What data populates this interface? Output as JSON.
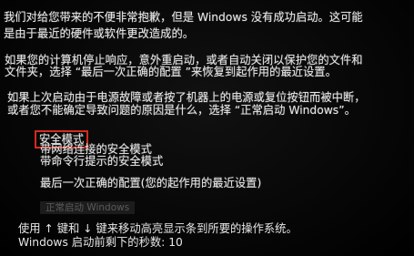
{
  "intro": {
    "line1": "我们对给您带来的不便非常抱歉，但是 Windows 没有成功启动。这可能",
    "line2": "是由于最近的硬件或软件更改造成的。"
  },
  "paragraph2": {
    "line1": "如果您的计算机停止响应，意外重启动，或者自动关闭以保护您的文件和",
    "line2": "文件夹，选择 “最后一次正确的配置 ”来恢复到起作用的最近设置。"
  },
  "paragraph3": {
    "line1": "如果上次启动由于电源故障或者按了机器上的电源或复位按钮而被中断，",
    "line2": "或者您不能确定导致问题的原因是什么，选择 “正常启动 Windows”。"
  },
  "menu": {
    "safe_mode": "安全模式",
    "safe_mode_networking": "带网络连接的安全模式",
    "safe_mode_cmd": "带命令行提示的安全模式",
    "last_known_good": "最后一次正确的配置(您的起作用的最近设置)",
    "start_normally": "正常启动 Windows"
  },
  "footer": {
    "instructions": "使用 ↑ 键和 ↓ 键来移动高亮显示条到所要的操作系统。",
    "countdown": "Windows 启动前剩下的秒数: 10"
  },
  "colors": {
    "background": "#070707",
    "text": "#e6e6e6",
    "highlight_border": "#d42a1f"
  }
}
